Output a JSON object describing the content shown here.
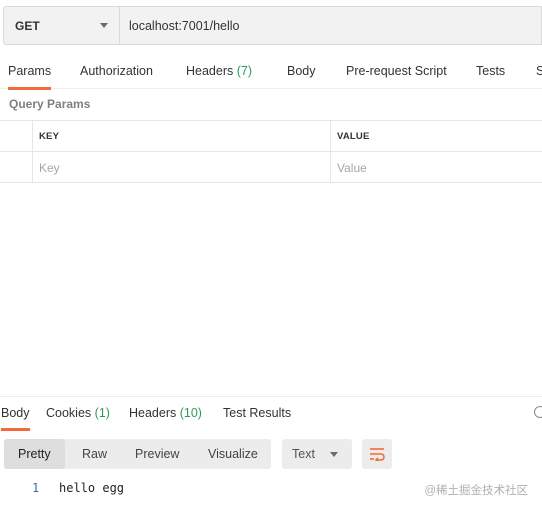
{
  "request": {
    "method": "GET",
    "url": "localhost:7001/hello"
  },
  "request_tabs": [
    {
      "label": "Params"
    },
    {
      "label": "Authorization"
    },
    {
      "label": "Headers",
      "count": "(7)"
    },
    {
      "label": "Body"
    },
    {
      "label": "Pre-request Script"
    },
    {
      "label": "Tests"
    },
    {
      "label": "S"
    }
  ],
  "params": {
    "section_label": "Query Params",
    "header_key": "KEY",
    "header_value": "VALUE",
    "placeholder_key": "Key",
    "placeholder_value": "Value"
  },
  "response_tabs": [
    {
      "label": "Body"
    },
    {
      "label": "Cookies",
      "count": "(1)"
    },
    {
      "label": "Headers",
      "count": "(10)"
    },
    {
      "label": "Test Results"
    }
  ],
  "view_modes": [
    "Pretty",
    "Raw",
    "Preview",
    "Visualize"
  ],
  "format": "Text",
  "code": {
    "line_number": "1",
    "text": "hello egg"
  },
  "watermark": "@稀土掘金技术社区",
  "colors": {
    "accent": "#f26b3a",
    "count": "#2e9a5c"
  }
}
